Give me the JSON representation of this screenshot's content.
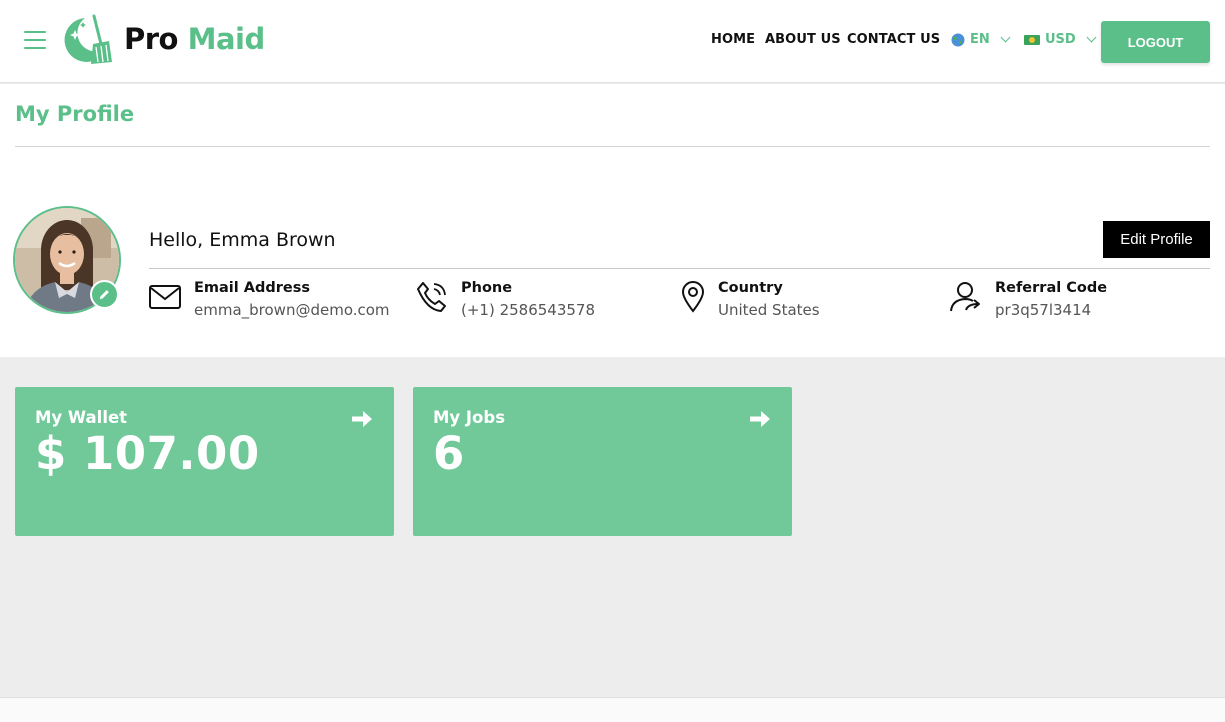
{
  "header": {
    "brand_part1": "Pro",
    "brand_part2": "Maid",
    "nav": {
      "home": "HOME",
      "about": "ABOUT US",
      "contact": "CONTACT US"
    },
    "language": "EN",
    "currency": "USD",
    "logout_label": "LOGOUT"
  },
  "page": {
    "title": "My Profile"
  },
  "profile": {
    "greeting": "Hello, Emma Brown",
    "edit_label": "Edit Profile",
    "email_label": "Email Address",
    "email_value": "emma_brown@demo.com",
    "phone_label": "Phone",
    "phone_value": "(+1) 2586543578",
    "country_label": "Country",
    "country_value": "United States",
    "referral_label": "Referral Code",
    "referral_value": "pr3q57l3414"
  },
  "cards": {
    "wallet_label": "My Wallet",
    "wallet_value": "$ 107.00",
    "jobs_label": "My Jobs",
    "jobs_value": "6"
  },
  "colors": {
    "brand_green": "#5bbf8a",
    "card_green": "#71c99a",
    "edit_button": "#000000"
  },
  "icons": {
    "menu": "hamburger-menu-icon",
    "logo": "broom-moon-logo-icon",
    "language": "globe-icon",
    "currency": "flag-icon",
    "avatar_edit": "pencil-icon",
    "email": "envelope-icon",
    "phone": "phone-icon",
    "country": "map-pin-icon",
    "referral": "user-share-icon",
    "card_arrow": "arrow-right-icon"
  }
}
